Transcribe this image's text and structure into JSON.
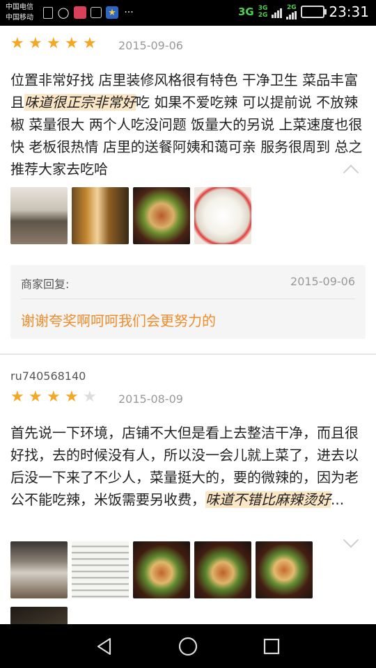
{
  "status_bar": {
    "carrier1": "中国电信",
    "carrier2": "中国移动",
    "network_main": "3G",
    "network_sim1": "3G",
    "network_sim2": "2G",
    "network_tag": "2G",
    "time": "23:31"
  },
  "reviews": [
    {
      "rating": 5,
      "date": "2015-09-06",
      "text_before": "位置非常好找 店里装修风格很有特色 干净卫生 菜品丰富 且",
      "text_highlight": "味道很正宗非常好",
      "text_after": "吃 如果不爱吃辣 可以提前说 不放辣椒 菜量很大 两个人吃没问题 饭量大的另说 上菜速度也很快 老板很热情 店里的送餐阿姨和蔼可亲 服务很周到 总之推荐大家去吃哈",
      "photos": [
        "restaurant-interior",
        "drink-bottles",
        "stir-fry-dish",
        "white-rice"
      ],
      "merchant_reply": {
        "label": "商家回复:",
        "date": "2015-09-06",
        "text": "谢谢夸奖啊呵呵我们会更努力的"
      }
    },
    {
      "username": "ru740568140",
      "rating": 4,
      "date": "2015-08-09",
      "text_before": "首先说一下环境，店铺不大但是看上去整洁干净，而且很好找，去的时候没有人，所以没一会儿就上菜了，进去以后没一下来了不少人，菜量挺大的，要的微辣的，因为老公不能吃辣，米饭需要另收费，",
      "text_highlight": "味道不错比麻辣烫好",
      "text_after": "...",
      "photos": [
        "restaurant-interior",
        "receipt",
        "stir-fry-dish",
        "stir-fry-dish",
        "stir-fry-dish",
        "dark-interior"
      ]
    }
  ],
  "colors": {
    "star_on": "#f5a623",
    "star_off": "#dcdcdc",
    "reply_text": "#f08c2a",
    "highlight_bg": "#fbe7c6"
  },
  "icons": {
    "back": "back-triangle-icon",
    "home": "home-circle-icon",
    "recents": "recents-square-icon"
  }
}
